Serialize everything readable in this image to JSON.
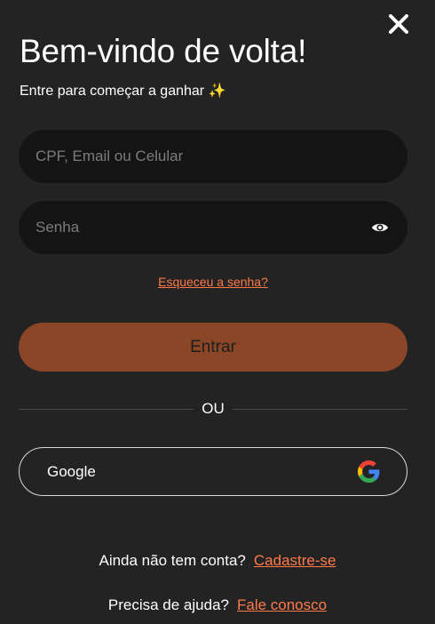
{
  "header": {
    "title": "Bem-vindo de volta!",
    "subtitle": "Entre para começar a ganhar ✨"
  },
  "form": {
    "login_placeholder": "CPF, Email ou Celular",
    "password_placeholder": "Senha",
    "forgot_password": "Esqueceu a senha?",
    "submit_label": "Entrar"
  },
  "divider": {
    "label": "OU"
  },
  "social": {
    "google_label": "Google"
  },
  "footer": {
    "signup_prompt": "Ainda não tem conta?",
    "signup_link": "Cadastre-se",
    "help_prompt": "Precisa de ajuda?",
    "help_link": "Fale conosco"
  },
  "colors": {
    "background": "#232323",
    "input_background": "#141414",
    "primary_button": "#8b4628",
    "link": "#ff7a48"
  },
  "icons": [
    "close-icon",
    "eye-icon",
    "google-icon"
  ]
}
